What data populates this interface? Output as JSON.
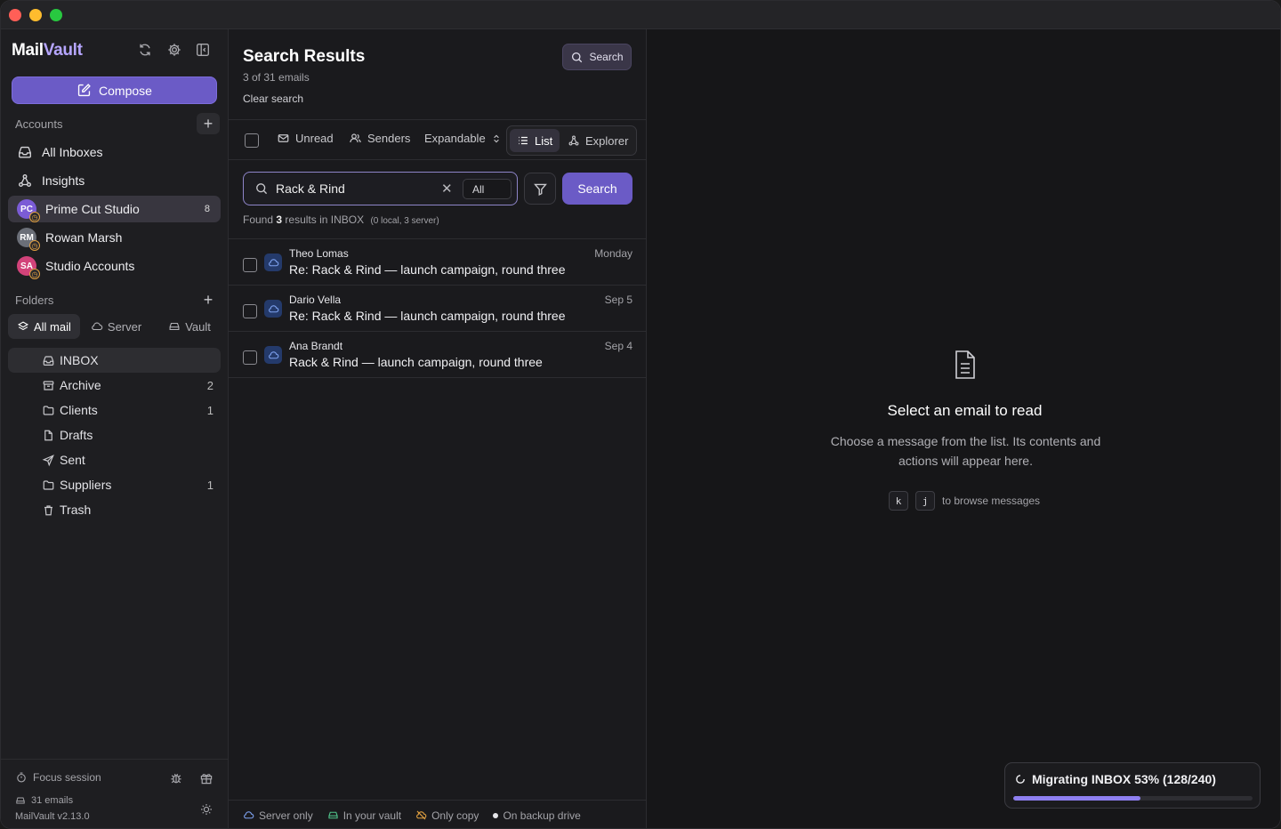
{
  "app": {
    "brand_main": "Mail",
    "brand_accent": "Vault"
  },
  "sidebar": {
    "compose_label": "Compose",
    "accounts_label": "Accounts",
    "accounts": [
      {
        "label": "All Inboxes",
        "icon": "inbox-icon"
      },
      {
        "label": "Insights",
        "icon": "insights-icon"
      },
      {
        "label": "Prime Cut Studio",
        "initials": "PC",
        "color": "#7b5cd6",
        "count": "8",
        "active": true
      },
      {
        "label": "Rowan Marsh",
        "initials": "RM",
        "color": "#6b6f78"
      },
      {
        "label": "Studio Accounts",
        "initials": "SA",
        "color": "#d2437a"
      }
    ],
    "folders_label": "Folders",
    "folder_tabs": [
      {
        "label": "All mail",
        "icon": "layers-icon",
        "active": true
      },
      {
        "label": "Server",
        "icon": "cloud-icon"
      },
      {
        "label": "Vault",
        "icon": "vault-icon"
      }
    ],
    "folders": [
      {
        "label": "INBOX",
        "icon": "inbox-icon",
        "count": "",
        "active": true
      },
      {
        "label": "Archive",
        "icon": "archive-icon",
        "count": "2"
      },
      {
        "label": "Clients",
        "icon": "folder-icon",
        "count": "1"
      },
      {
        "label": "Drafts",
        "icon": "file-icon",
        "count": ""
      },
      {
        "label": "Sent",
        "icon": "send-icon",
        "count": ""
      },
      {
        "label": "Suppliers",
        "icon": "folder-icon",
        "count": "1"
      },
      {
        "label": "Trash",
        "icon": "trash-icon",
        "count": ""
      }
    ],
    "footer": {
      "focus_label": "Focus session",
      "emails_label": "31 emails",
      "version": "MailVault v2.13.0"
    }
  },
  "middle": {
    "title": "Search Results",
    "subtitle": "3 of 31 emails",
    "clear_search": "Clear search",
    "search_button": "Search",
    "toolbar": {
      "unread": "Unread",
      "senders": "Senders",
      "expandable": "Expandable",
      "list": "List",
      "explorer": "Explorer"
    },
    "search": {
      "query": "Rack & Rind",
      "scope": "All",
      "button": "Search"
    },
    "found": {
      "prefix": "Found",
      "count": "3",
      "suffix": "results in INBOX",
      "detail": "(0 local, 3 server)"
    },
    "emails": [
      {
        "sender": "Theo Lomas",
        "subject": "Re: Rack & Rind — launch campaign, round three",
        "date": "Monday"
      },
      {
        "sender": "Dario Vella",
        "subject": "Re: Rack & Rind — launch campaign, round three",
        "date": "Sep 5"
      },
      {
        "sender": "Ana Brandt",
        "subject": "Rack & Rind — launch campaign, round three",
        "date": "Sep 4"
      }
    ],
    "legend": {
      "server_only": "Server only",
      "in_vault": "In your vault",
      "only_copy": "Only copy",
      "backup": "On backup drive"
    }
  },
  "reader": {
    "title": "Select an email to read",
    "description": "Choose a message from the list. Its contents and actions will appear here.",
    "key_k": "k",
    "key_j": "j",
    "key_hint": "to browse messages"
  },
  "migration": {
    "label": "Migrating INBOX 53% (128/240)",
    "progress": 0.53
  },
  "colors": {
    "accent": "#6b5bc6",
    "progress": "#8e7ff0"
  }
}
